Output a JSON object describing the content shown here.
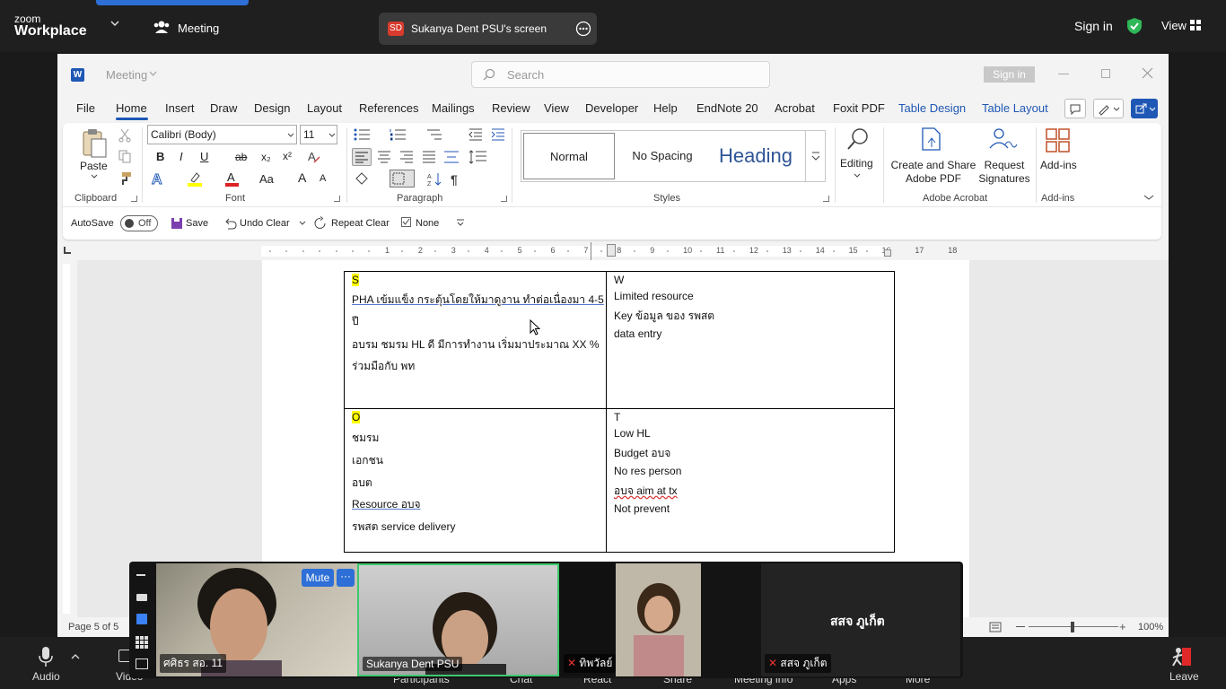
{
  "zoom": {
    "logo_top": "zoom",
    "logo_bottom": "Workplace",
    "meeting_label": "Meeting",
    "share_initials": "SD",
    "share_title": "Sukanya Dent PSU's screen",
    "sign_in": "Sign in",
    "view": "View",
    "toolbar": [
      "Audio",
      "Video",
      "Participants",
      "Chat",
      "React",
      "Share",
      "Meeting info",
      "Apps",
      "More"
    ],
    "leave": "Leave",
    "mute_button": "Mute",
    "participants": [
      {
        "name": "ศศิธร สอ. 11"
      },
      {
        "name": "Sukanya Dent PSU"
      },
      {
        "name": "ทิพวัลย์"
      },
      {
        "name": "สสจ ภูเก็ต",
        "display": "สสจ ภูเก็ต"
      }
    ]
  },
  "word": {
    "title": "Meeting",
    "search_placeholder": "Search",
    "sign_in": "Sign in",
    "tabs": [
      "File",
      "Home",
      "Insert",
      "Draw",
      "Design",
      "Layout",
      "References",
      "Mailings",
      "Review",
      "View",
      "Developer",
      "Help",
      "EndNote 20",
      "Acrobat",
      "Foxit PDF",
      "Table Design",
      "Table Layout"
    ],
    "active_tab": "Home",
    "clipboard": {
      "paste": "Paste",
      "label": "Clipboard"
    },
    "font": {
      "family": "Calibri (Body)",
      "size": "11",
      "label": "Font",
      "bold": "B",
      "italic": "I",
      "underline": "U",
      "strike": "ab",
      "sub": "x₂",
      "sup": "x²",
      "case": "Aa",
      "grow": "A",
      "shrink": "A"
    },
    "paragraph": {
      "label": "Paragraph"
    },
    "styles": {
      "normal": "Normal",
      "no_spacing": "No Spacing",
      "heading": "Heading",
      "label": "Styles"
    },
    "editing": "Editing",
    "acrobat": {
      "create_share_1": "Create and Share",
      "create_share_2": "Adobe PDF",
      "request_1": "Request",
      "request_2": "Signatures",
      "label": "Adobe Acrobat"
    },
    "addins": {
      "button": "Add-ins",
      "label": "Add-ins"
    },
    "qat": {
      "autosave": "AutoSave",
      "off": "Off",
      "save": "Save",
      "undo": "Undo Clear",
      "repeat": "Repeat Clear",
      "none": "None"
    },
    "status": {
      "page": "Page 5 of 5",
      "zoom": "100%"
    },
    "ruler_numbers": [
      "1",
      "2",
      "3",
      "4",
      "5",
      "6",
      "7",
      "8",
      "9",
      "10",
      "11",
      "12",
      "13",
      "14",
      "15",
      "16",
      "17",
      "18"
    ]
  },
  "document": {
    "s_head": "S",
    "s_lines": [
      "PHA  เข้มแข็ง กระตุ้นโดยให้มาดูงาน ทำต่อเนื่องมา 4-5",
      "ปี",
      "อบรม ชมรม HL ดี มีการทำงาน เริ่มมาประมาณ XX %",
      "ร่วมมือกับ พท"
    ],
    "w_head": "W",
    "w_lines": [
      "Limited resource",
      "Key ข้อมูล ของ รพสต",
      "data entry"
    ],
    "o_head": "O",
    "o_lines": [
      "ชมรม",
      "เอกชน",
      "อบต",
      "Resource  อบจ",
      "รพสต service delivery"
    ],
    "t_head": "T",
    "t_lines": [
      "Low HL",
      "Budget อบจ",
      "No res person",
      "อบจ aim at tx",
      "Not prevent"
    ]
  },
  "colors": {
    "zoom_bg": "#1f1f1f",
    "word_accent": "#1f57b5",
    "highlight": "#ffff00",
    "active_speaker": "#3ec96c",
    "leave_red": "#e02828"
  }
}
